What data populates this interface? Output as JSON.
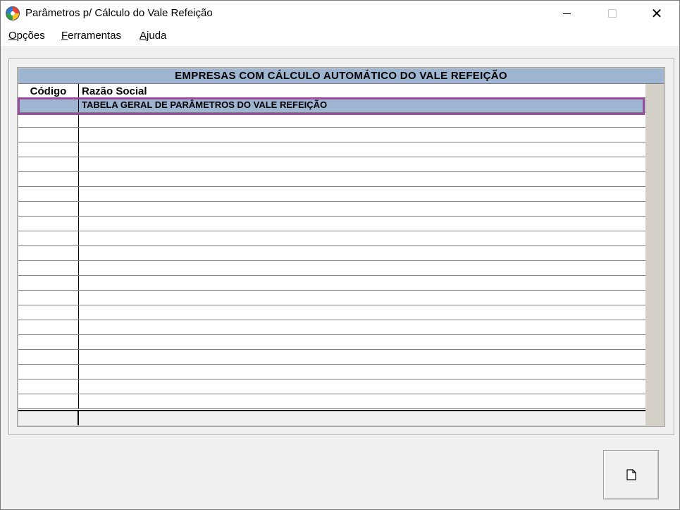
{
  "window": {
    "title": "Parâmetros p/ Cálculo do Vale Refeição",
    "close_glyph": "✕"
  },
  "menu": {
    "items": [
      "Opções",
      "Ferramentas",
      "Ajuda"
    ]
  },
  "grid": {
    "title": "EMPRESAS COM CÁLCULO AUTOMÁTICO DO VALE REFEIÇÃO",
    "columns": [
      "Código",
      "Razão Social"
    ],
    "rows": [
      {
        "codigo": "",
        "razao_social": "TABELA GERAL DE PARÂMETROS DO VALE REFEIÇÃO",
        "selected": true
      }
    ],
    "selection_color": "#9b4d9b",
    "header_color": "#9db5d0"
  },
  "toolbar": {
    "new_button_icon": "new-document-icon"
  }
}
